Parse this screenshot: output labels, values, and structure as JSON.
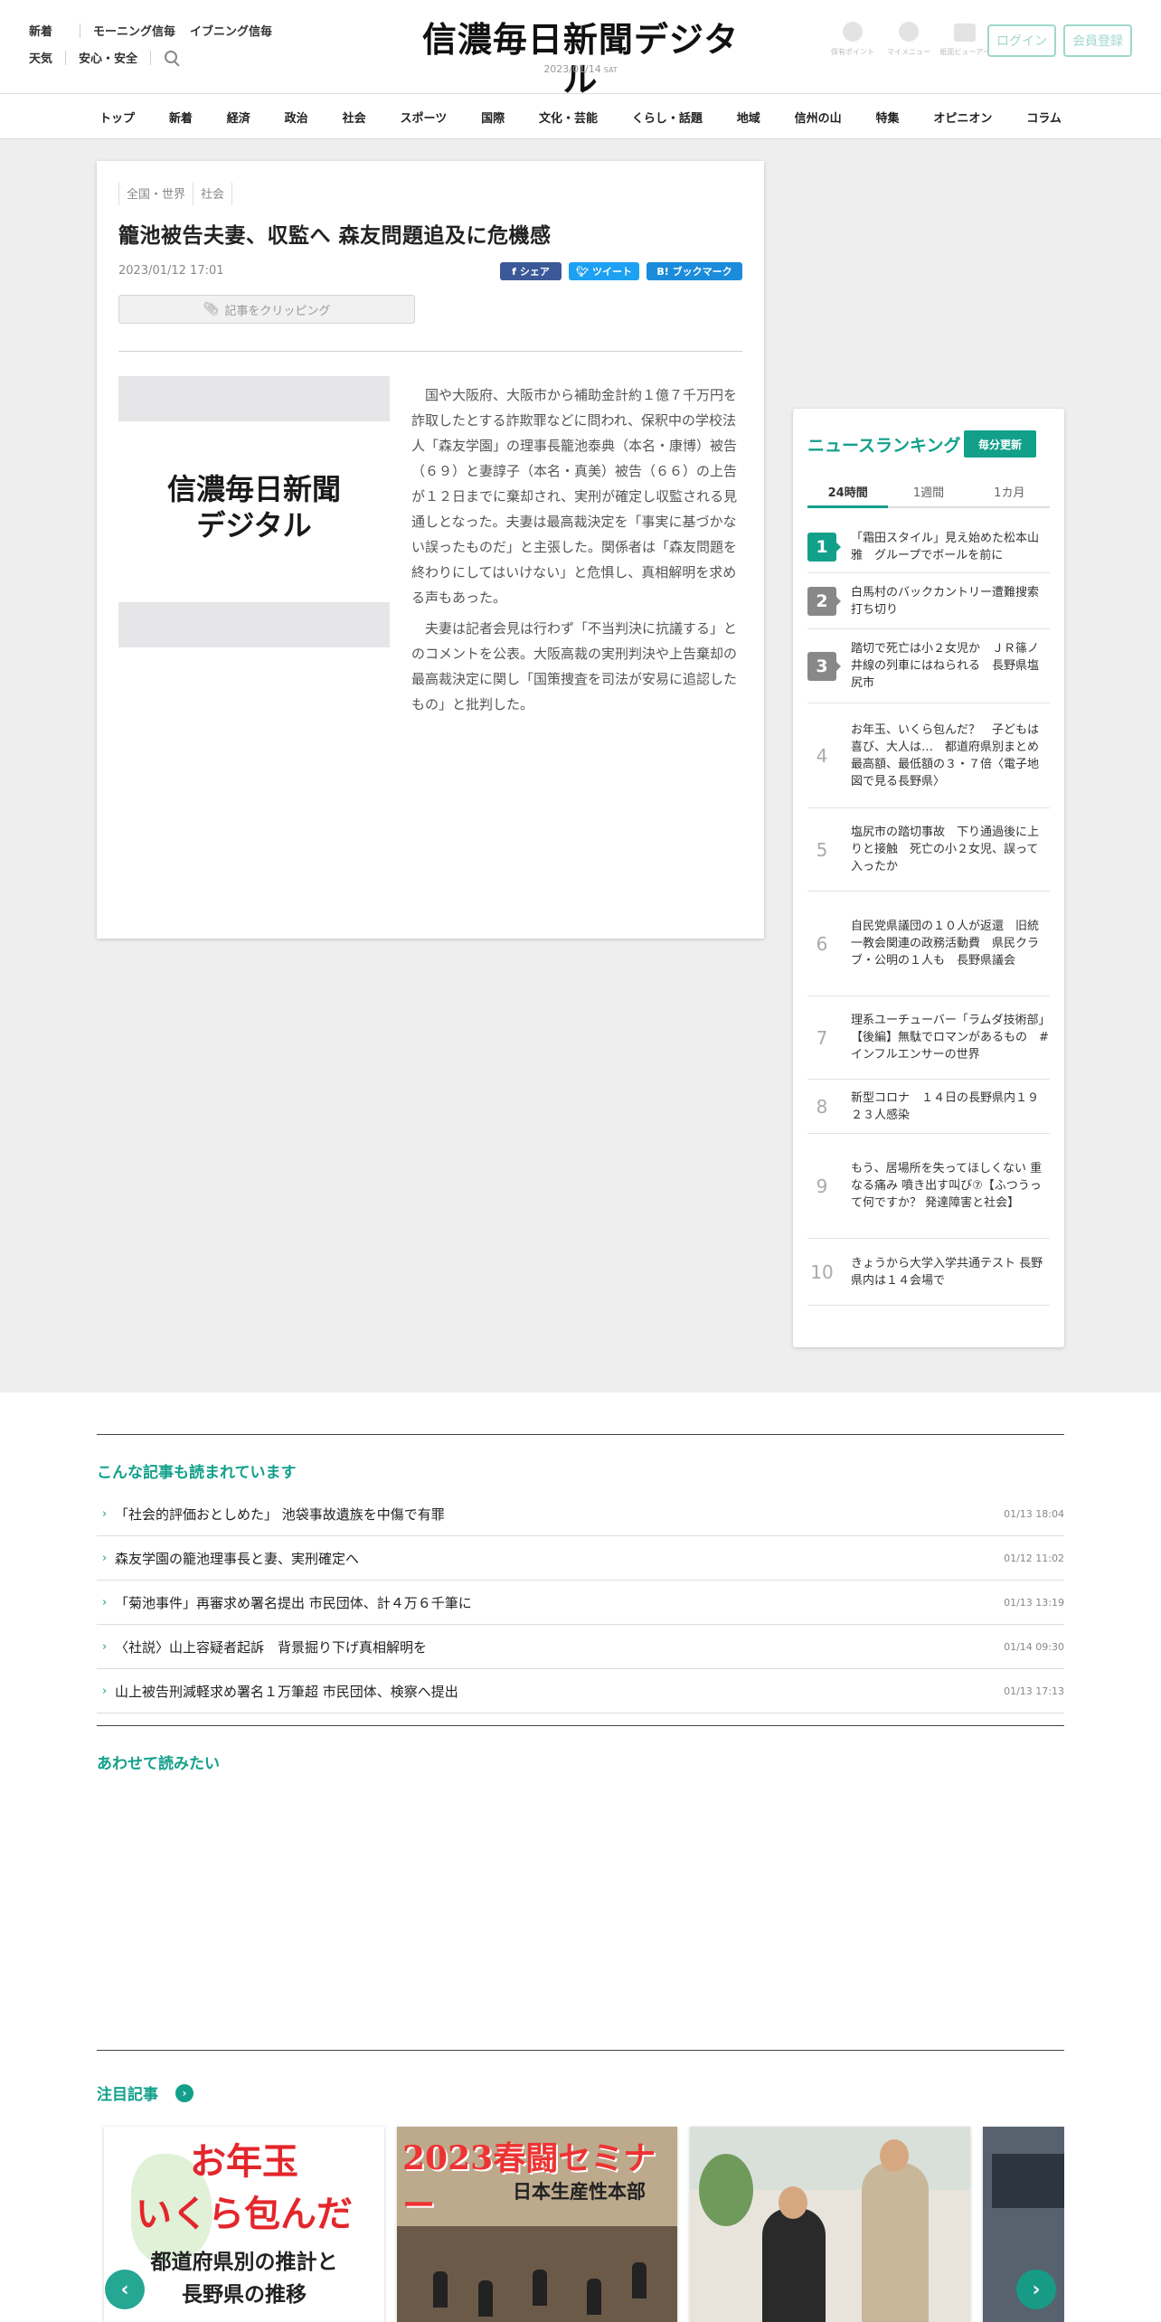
{
  "header": {
    "nav_row1": [
      "新着",
      "モーニング信毎",
      "イブニング信毎"
    ],
    "nav_row2": [
      "天気",
      "安心・安全"
    ],
    "logo": "信濃毎日新聞デジタル",
    "date": "2023/01/14",
    "weekday": "SAT",
    "icons": [
      {
        "name": "point-icon",
        "label": "保有ポイント"
      },
      {
        "name": "mypage-icon",
        "label": "マイメニュー"
      },
      {
        "name": "viewer-icon",
        "label": "紙面ビューアー"
      }
    ],
    "login": "ログイン",
    "register": "会員登録"
  },
  "categories": [
    "トップ",
    "新着",
    "経済",
    "政治",
    "社会",
    "スポーツ",
    "国際",
    "文化・芸能",
    "くらし・話題",
    "地域",
    "信州の山",
    "特集",
    "オピニオン",
    "コラム"
  ],
  "article": {
    "tags": [
      "全国・世界",
      "社会"
    ],
    "title": "籠池被告夫妻、収監へ 森友問題追及に危機感",
    "date": "2023/01/12 17:01",
    "share_facebook": "シェア",
    "share_twitter": "ツイート",
    "share_hatena": "B! ブックマーク",
    "clip": "記事をクリッピング",
    "photo_logo_line1": "信濃毎日新聞",
    "photo_logo_line2": "デジタル",
    "paragraphs": [
      "国や大阪府、大阪市から補助金計約１億７千万円を詐取したとする詐欺罪などに問われ、保釈中の学校法人「森友学園」の理事長籠池泰典（本名・康博）被告（６９）と妻諄子（本名・真美）被告（６６）の上告が１２日までに棄却され、実刑が確定し収監される見通しとなった。夫妻は最高裁決定を「事実に基づかない誤ったものだ」と主張した。関係者は「森友問題を終わりにしてはいけない」と危惧し、真相解明を求める声もあった。",
      "夫妻は記者会見は行わず「不当判決に抗議する」とのコメントを公表。大阪高裁の実刑判決や上告棄却の最高裁決定に関し「国策捜査を司法が安易に追認したもの」と批判した。"
    ]
  },
  "ranking": {
    "title": "ニュースランキング",
    "badge": "毎分更新",
    "tabs": [
      "24時間",
      "1週間",
      "1カ月"
    ],
    "active_tab": "24時間",
    "items": [
      {
        "rank": "1",
        "text": "「霜田スタイル」見え始めた松本山雅　グループでボールを前に"
      },
      {
        "rank": "2",
        "text": "白馬村のバックカントリー遭難搜索打ち切り"
      },
      {
        "rank": "3",
        "text": "踏切で死亡は小２女児か　ＪＲ篠ノ井線の列車にはねられる　長野県塩尻市"
      },
      {
        "rank": "4",
        "text": "お年玉、いくら包んだ？　子どもは喜び、大人は…　都道府県別まとめ　最高額、最低額の３・７倍〈電子地図で見る長野県〉"
      },
      {
        "rank": "5",
        "text": "塩尻市の踏切事故　下り通過後に上りと接触　死亡の小２女児、誤って入ったか"
      },
      {
        "rank": "6",
        "text": "自民党県議団の１０人が返還　旧統一教会関連の政務活動費　県民クラブ・公明の１人も　長野県議会"
      },
      {
        "rank": "7",
        "text": "理系ユーチューバー「ラムダ技術部」　【後編】無駄でロマンがあるもの　#インフルエンサーの世界"
      },
      {
        "rank": "8",
        "text": "新型コロナ　１４日の長野県内１９２３人感染"
      },
      {
        "rank": "9",
        "text": "もう、居場所を失ってほしくない 重なる痛み 噴き出す叫び⑦【ふつうって何ですか？ 発達障害と社会】"
      },
      {
        "rank": "10",
        "text": "きょうから大学入学共通テスト 長野県内は１４会場で"
      }
    ]
  },
  "related": {
    "title": "こんな記事も読まれています",
    "items": [
      {
        "title": "「社会的評価おとしめた」 池袋事故遺族を中傷で有罪",
        "date": "01/13 18:04"
      },
      {
        "title": "森友学園の籠池理事長と妻、実刑確定へ",
        "date": "01/12 11:02"
      },
      {
        "title": "「菊池事件」再審求め署名提出 市民団体、計４万６千筆に",
        "date": "01/13 13:19"
      },
      {
        "title": "〈社説〉山上容疑者起訴　背景掘り下げ真相解明を",
        "date": "01/14 09:30"
      },
      {
        "title": "山上被告刑減軽求め署名１万筆超 市民団体、検察へ提出",
        "date": "01/13 17:13"
      }
    ]
  },
  "also_read": {
    "title": "あわせて読みたい"
  },
  "featured": {
    "title": "注目記事",
    "arrow": "›",
    "slide1": [
      "お年玉",
      "いくら包んだ",
      "都道府県別の推計と",
      "長野県の推移"
    ],
    "slide2": [
      "2023春闘セミナー",
      "日本生産性本部"
    ],
    "prev": "‹",
    "next": "›"
  },
  "colors": {
    "accent": "#12a08a",
    "band": "#eeeeee"
  }
}
